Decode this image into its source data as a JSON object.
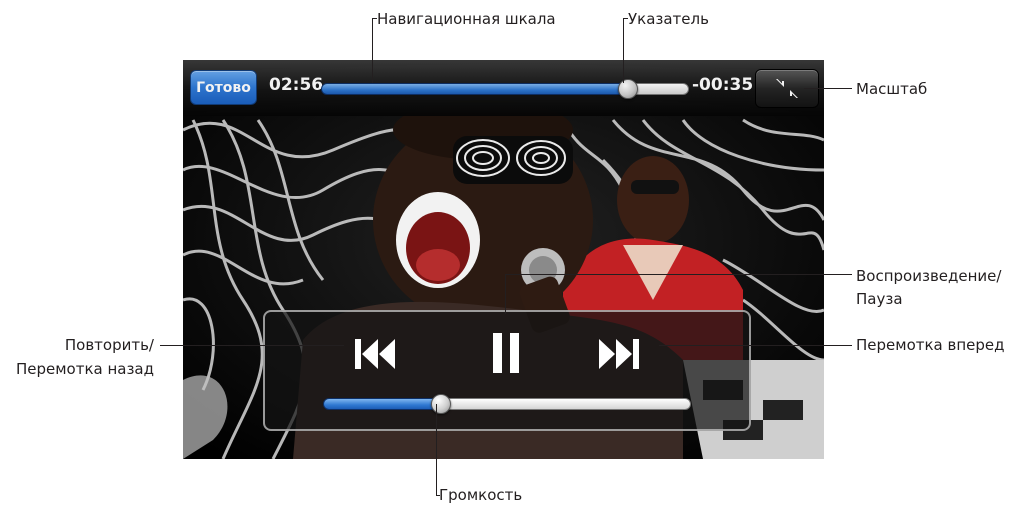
{
  "callouts": {
    "scrubber": "Навигационная шкала",
    "playhead": "Указатель",
    "scale": "Масштаб",
    "play_pause_1": "Воспроизведение/",
    "play_pause_2": "Пауза",
    "restart_rewind_1": "Повторить/",
    "restart_rewind_2": "Перемотка назад",
    "fast_forward": "Перемотка вперед",
    "volume": "Громкость"
  },
  "player": {
    "done_label": "Готово",
    "elapsed_time": "02:56",
    "remaining_time": "-00:35",
    "playback_progress": 0.835,
    "volume_level": 0.32
  },
  "colors": {
    "accent": "#2f7ad8",
    "label_text": "#231f20"
  },
  "icons": {
    "zoom": "shrink-arrows-icon",
    "previous": "previous-track-icon",
    "pause": "pause-icon",
    "next": "next-track-icon"
  }
}
